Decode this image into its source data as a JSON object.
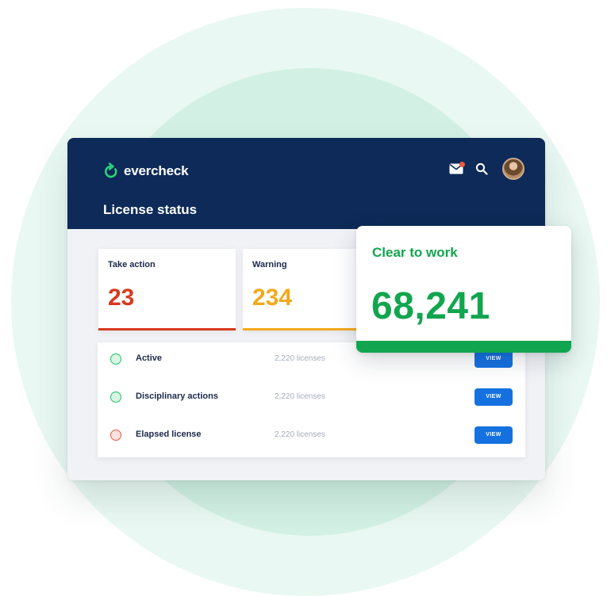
{
  "app": {
    "logo_text": "evercheck",
    "page_title": "License status"
  },
  "stats": [
    {
      "label": "Take action",
      "value": "23",
      "color": "#d63a1e"
    },
    {
      "label": "Warning",
      "value": "234",
      "color": "#f2a91e"
    }
  ],
  "clear_to_work": {
    "label": "Clear to work",
    "value": "68,241",
    "color": "#12a54f"
  },
  "licenses": [
    {
      "label": "Active",
      "count": "2,220 licenses",
      "button": "VIEW",
      "status_color": "#1fbf66"
    },
    {
      "label": "Disciplinary actions",
      "count": "2,220 licenses",
      "button": "VIEW",
      "status_color": "#1fbf66"
    },
    {
      "label": "Elapsed license",
      "count": "2,220 licenses",
      "button": "VIEW",
      "status_color": "#e8553c"
    }
  ],
  "icons": {
    "logo": "evercheck-refresh-check-icon",
    "mail": "mail-icon",
    "search": "search-icon",
    "avatar": "user-avatar"
  }
}
